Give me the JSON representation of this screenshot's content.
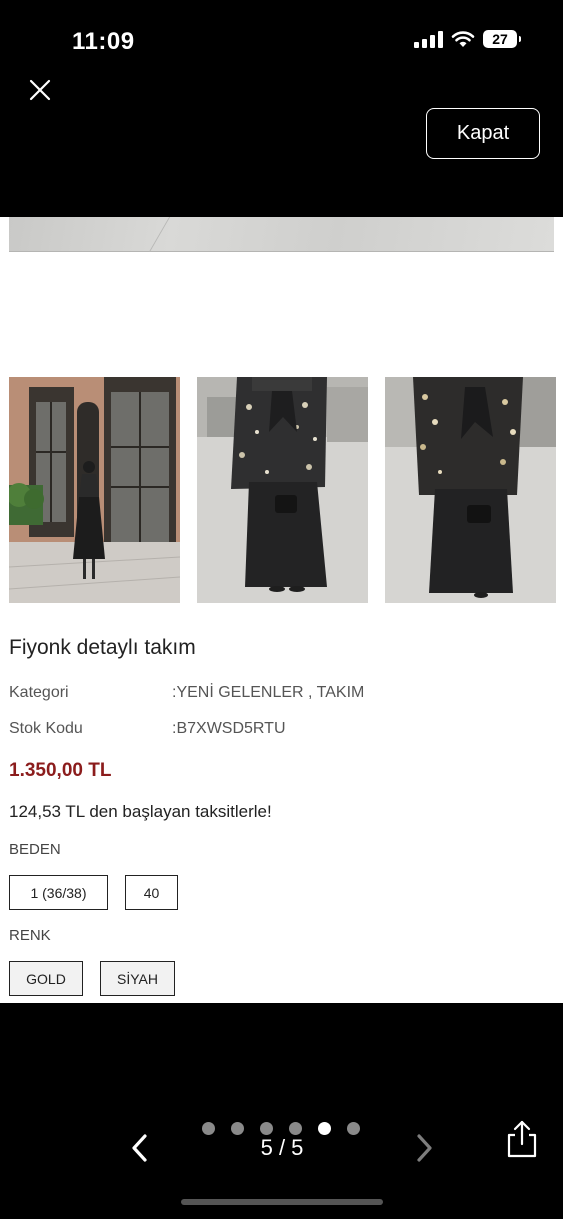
{
  "status_bar": {
    "time": "11:09",
    "battery": "27",
    "icons": [
      "signal-icon",
      "wifi-icon",
      "battery-icon"
    ]
  },
  "top_bar": {
    "close_icon": "close-icon",
    "kapat_label": "Kapat"
  },
  "product": {
    "title": "Fiyonk detaylı takım",
    "category_label": "Kategori",
    "category_value": ":YENİ GELENLER , TAKIM",
    "sku_label": "Stok Kodu",
    "sku_value": ":B7XWSD5RTU",
    "price": "1.350,00 TL",
    "installment": "124,53 TL den başlayan taksitlerle!",
    "size_label": "BEDEN",
    "sizes": [
      "1 (36/38)",
      "40"
    ],
    "color_label": "RENK",
    "colors": [
      "GOLD",
      "SİYAH"
    ]
  },
  "gallery": {
    "thumbnails": [
      "thumbnail-1",
      "thumbnail-2",
      "thumbnail-3"
    ]
  },
  "bottom_bar": {
    "counter": "5 / 5",
    "dot_count": 6,
    "active_dot": 5,
    "prev_icon": "chevron-left-icon",
    "next_icon": "chevron-right-icon",
    "share_icon": "share-icon"
  },
  "colors": {
    "price": "#8b1c1c",
    "background": "#000000",
    "content_bg": "#ffffff"
  }
}
